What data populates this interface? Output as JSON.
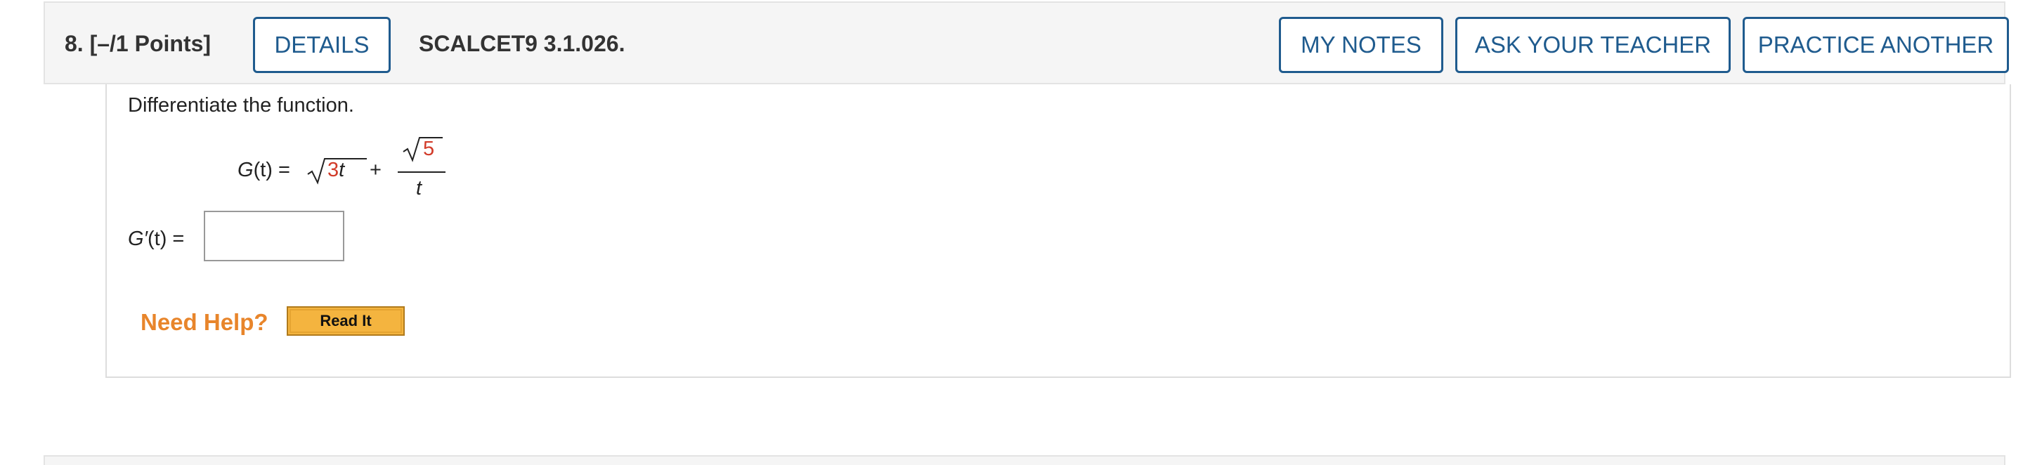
{
  "question": {
    "number_points": "8.  [–/1 Points]",
    "source": "SCALCET9 3.1.026.",
    "buttons": {
      "details": "DETAILS",
      "my_notes": "MY NOTES",
      "ask_teacher": "ASK YOUR TEACHER",
      "practice_another": "PRACTICE ANOTHER"
    }
  },
  "body": {
    "prompt": "Differentiate the function.",
    "equation": {
      "lhs_func": "G",
      "lhs_arg": "(t)",
      "equals": " = ",
      "radicand_coef": "3",
      "radicand_var": "t",
      "plus": "+",
      "numerator_radicand": "5",
      "denominator": "t"
    },
    "answer": {
      "label_func": "G′",
      "label_arg": "(t)",
      "label_equals": " =",
      "value": ""
    },
    "help": {
      "label": "Need Help?",
      "read_it": "Read It"
    }
  },
  "colors": {
    "accent_blue": "#1f5b8e",
    "highlight_red": "#d23c2a",
    "help_orange": "#e8852b",
    "read_it_fill": "#f4b43f"
  }
}
